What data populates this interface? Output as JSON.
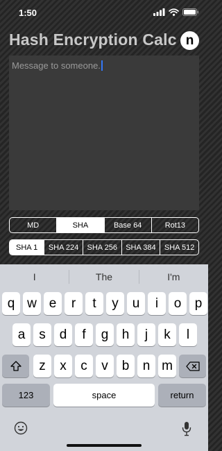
{
  "status_bar": {
    "time": "1:50"
  },
  "header": {
    "title": "Hash Encryption Calc",
    "logo_letter": "n"
  },
  "message": {
    "placeholder": "Message to someone."
  },
  "algorithm_tabs": [
    {
      "label": "MD",
      "selected": false
    },
    {
      "label": "SHA",
      "selected": true
    },
    {
      "label": "Base 64",
      "selected": false
    },
    {
      "label": "Rot13",
      "selected": false
    }
  ],
  "sha_variant_tabs": [
    {
      "label": "SHA 1",
      "selected": true
    },
    {
      "label": "SHA 224",
      "selected": false
    },
    {
      "label": "SHA 256",
      "selected": false
    },
    {
      "label": "SHA 384",
      "selected": false
    },
    {
      "label": "SHA 512",
      "selected": false
    }
  ],
  "keyboard": {
    "suggestions": [
      "I",
      "The",
      "I'm"
    ],
    "row1": [
      "q",
      "w",
      "e",
      "r",
      "t",
      "y",
      "u",
      "i",
      "o",
      "p"
    ],
    "row2": [
      "a",
      "s",
      "d",
      "f",
      "g",
      "h",
      "j",
      "k",
      "l"
    ],
    "row3": [
      "z",
      "x",
      "c",
      "v",
      "b",
      "n",
      "m"
    ],
    "numbers_label": "123",
    "space_label": "space",
    "return_label": "return"
  },
  "colors": {
    "accent_cursor": "#3478f6",
    "title": "#c8c8c8",
    "keyboard_bg": "#d1d4da"
  }
}
